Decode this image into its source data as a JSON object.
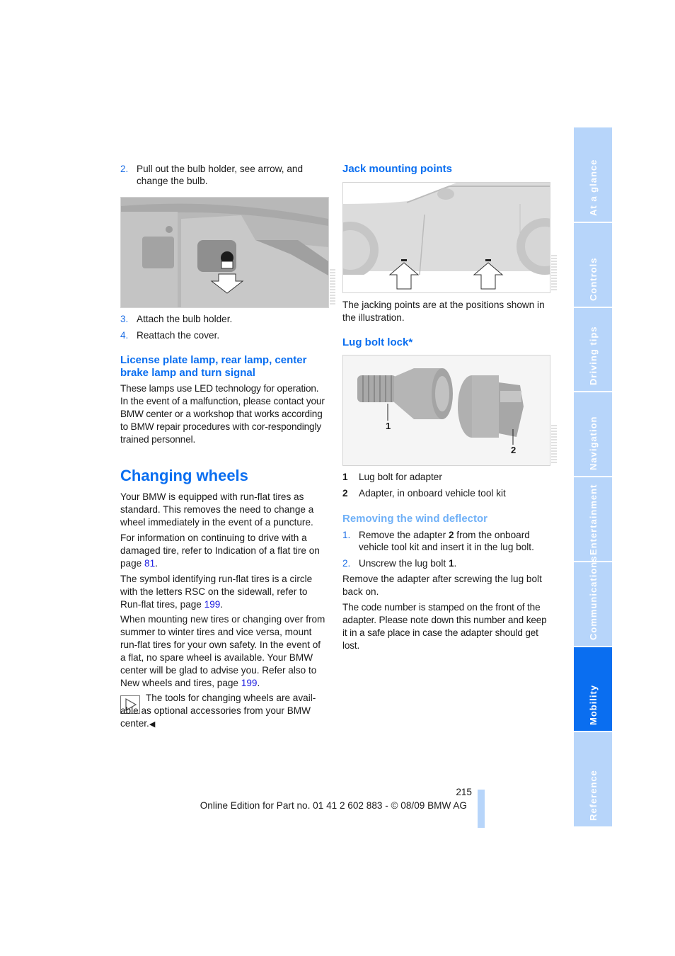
{
  "left_column": {
    "step2": {
      "num": "2.",
      "text": "Pull out the bulb holder, see arrow, and change the bulb."
    },
    "step3": {
      "num": "3.",
      "text": "Attach the bulb holder."
    },
    "step4": {
      "num": "4.",
      "text": "Reattach the cover."
    },
    "license_heading": "License plate lamp, rear lamp, center brake lamp and turn signal",
    "license_text": "These lamps use LED technology for operation. In the event of a malfunction, please contact your BMW center or a workshop that works according to BMW repair procedures with cor-respondingly trained personnel.",
    "changing_heading": "Changing wheels",
    "para1": "Your BMW is equipped with run-flat tires as standard. This removes the need to change a wheel immediately in the event of a puncture.",
    "para2_pre": "For information on continuing to drive with a damaged tire, refer to Indication of a flat tire on page ",
    "para2_link": "81",
    "para2_post": ".",
    "para3_pre": "The symbol identifying run-flat tires is a circle with the letters RSC on the sidewall, refer to Run-flat tires, page ",
    "para3_link": "199",
    "para3_post": ".",
    "para4_pre": "When mounting new tires or changing over from summer to winter tires and vice versa, mount run-flat tires for your own safety. In the event of a flat, no spare wheel is available. Your BMW center will be glad to advise you. Refer also to New wheels and tires, page ",
    "para4_link": "199",
    "para4_post": ".",
    "note_icon": "play-triangle-icon",
    "note_text": "The tools for changing wheels are avail-able as optional accessories from your BMW center.",
    "note_end": "◀"
  },
  "right_column": {
    "jack_heading": "Jack mounting points",
    "jack_caption": "The jacking points are at the positions shown in the illustration.",
    "lug_heading": "Lug bolt lock*",
    "lug_label1": "1",
    "lug_label2": "2",
    "legend": [
      {
        "num": "1",
        "text": "Lug bolt for adapter"
      },
      {
        "num": "2",
        "text": "Adapter, in onboard vehicle tool kit"
      }
    ],
    "wind_heading": "Removing the wind deflector",
    "wind_step1_num": "1.",
    "wind_step1_pre": "Remove the adapter ",
    "wind_step1_bold": "2",
    "wind_step1_post": " from the onboard vehicle tool kit and insert it in the lug bolt.",
    "wind_step2_num": "2.",
    "wind_step2_pre": "Unscrew the lug bolt ",
    "wind_step2_bold": "1",
    "wind_step2_post": ".",
    "para_remove": "Remove the adapter after screwing the lug bolt back on.",
    "para_code": "The code number is stamped on the front of the adapter. Please note down this number and keep it in a safe place in case the adapter should get lost."
  },
  "side_tabs": [
    {
      "label": "At a glance",
      "active": false
    },
    {
      "label": "Controls",
      "active": false
    },
    {
      "label": "Driving tips",
      "active": false
    },
    {
      "label": "Navigation",
      "active": false
    },
    {
      "label": "Entertainment",
      "active": false
    },
    {
      "label": "Communications",
      "active": false
    },
    {
      "label": "Mobility",
      "active": true
    },
    {
      "label": "Reference",
      "active": false
    }
  ],
  "footer": {
    "page_number": "215",
    "edition": "Online Edition for Part no. 01 41 2 602 883 - © 08/09 BMW AG"
  },
  "colors": {
    "heading_blue": "#0a6ef0",
    "subheading_light_blue": "#6fb0f7",
    "tab_inactive": "#b7d5fa",
    "tab_active": "#0a6ef0",
    "link": "#1a1ae0"
  }
}
